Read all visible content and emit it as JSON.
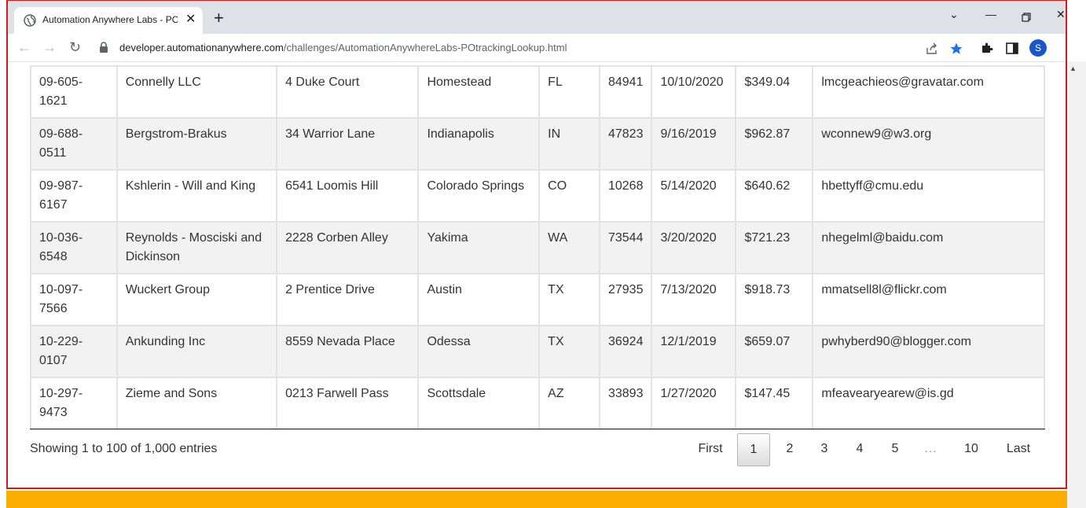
{
  "browser": {
    "tab_title": "Automation Anywhere Labs - PO",
    "url_host": "developer.automationanywhere.com",
    "url_path": "/challenges/AutomationAnywhereLabs-POtrackingLookup.html",
    "profile_initial": "S",
    "icons": [
      "globe-icon",
      "close-icon",
      "plus-icon",
      "chevron-down-icon",
      "minimize-icon",
      "restore-icon",
      "back-icon",
      "forward-icon",
      "reload-icon",
      "lock-icon",
      "share-icon",
      "star-icon",
      "puzzle-icon",
      "sidepanel-icon",
      "kebab-icon"
    ],
    "accent_color": "#1a73e8"
  },
  "table": {
    "rows": [
      {
        "po": "09-605-1621",
        "company": "Connelly LLC",
        "address": "4 Duke Court",
        "city": "Homestead",
        "state": "FL",
        "zip": "84941",
        "date": "10/10/2020",
        "total": "$349.04",
        "email": "lmcgeachieos@gravatar.com"
      },
      {
        "po": "09-688-0511",
        "company": "Bergstrom-Brakus",
        "address": "34 Warrior Lane",
        "city": "Indianapolis",
        "state": "IN",
        "zip": "47823",
        "date": "9/16/2019",
        "total": "$962.87",
        "email": "wconnew9@w3.org"
      },
      {
        "po": "09-987-6167",
        "company": "Kshlerin - Will and King",
        "address": "6541 Loomis Hill",
        "city": "Colorado Springs",
        "state": "CO",
        "zip": "10268",
        "date": "5/14/2020",
        "total": "$640.62",
        "email": "hbettyff@cmu.edu"
      },
      {
        "po": "10-036-6548",
        "company": "Reynolds - Mosciski and Dickinson",
        "address": "2228 Corben Alley",
        "city": "Yakima",
        "state": "WA",
        "zip": "73544",
        "date": "3/20/2020",
        "total": "$721.23",
        "email": "nhegelml@baidu.com"
      },
      {
        "po": "10-097-7566",
        "company": "Wuckert Group",
        "address": "2 Prentice Drive",
        "city": "Austin",
        "state": "TX",
        "zip": "27935",
        "date": "7/13/2020",
        "total": "$918.73",
        "email": "mmatsell8l@flickr.com"
      },
      {
        "po": "10-229-0107",
        "company": "Ankunding Inc",
        "address": "8559 Nevada Place",
        "city": "Odessa",
        "state": "TX",
        "zip": "36924",
        "date": "12/1/2019",
        "total": "$659.07",
        "email": "pwhyberd90@blogger.com"
      },
      {
        "po": "10-297-9473",
        "company": "Zieme and Sons",
        "address": "0213 Farwell Pass",
        "city": "Scottsdale",
        "state": "AZ",
        "zip": "33893",
        "date": "1/27/2020",
        "total": "$147.45",
        "email": "mfeavearyearew@is.gd"
      }
    ]
  },
  "footer": {
    "info": "Showing 1 to 100 of 1,000 entries",
    "pagination": [
      "First",
      "1",
      "2",
      "3",
      "4",
      "5",
      "…",
      "10",
      "Last"
    ],
    "current_page": "1"
  },
  "colors": {
    "frame_border": "#d01c1c",
    "stripe": "#f2f2f2",
    "banner": "#fbac00"
  }
}
